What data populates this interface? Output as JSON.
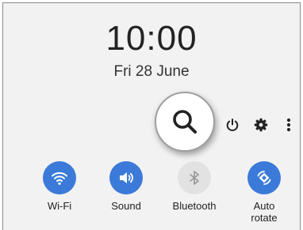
{
  "clock": {
    "time": "10:00",
    "date": "Fri 28 June"
  },
  "toolbar": {
    "search_icon": "search-icon",
    "power_icon": "power-icon",
    "settings_icon": "gear-icon",
    "more_icon": "more-vertical-icon"
  },
  "toggles": [
    {
      "label": "Wi-Fi",
      "icon": "wifi-icon",
      "state": "on"
    },
    {
      "label": "Sound",
      "icon": "volume-icon",
      "state": "on"
    },
    {
      "label": "Bluetooth",
      "icon": "bluetooth-icon",
      "state": "off"
    },
    {
      "label": "Auto\nrotate",
      "icon": "auto-rotate-icon",
      "state": "on"
    }
  ],
  "colors": {
    "accent": "#3b7ad8",
    "inactive": "#e2e2e2",
    "background": "#f2f2f2"
  }
}
